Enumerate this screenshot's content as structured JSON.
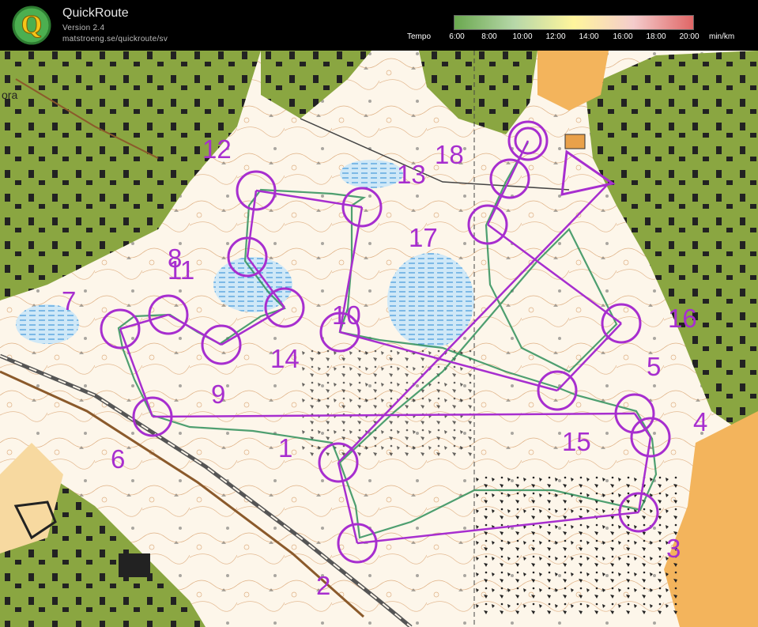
{
  "app": {
    "title": "QuickRoute",
    "version": "Version 2.4",
    "url": "matstroeng.se/quickroute/sv",
    "logo_letter": "Q"
  },
  "tempo_scale": {
    "label": "Tempo",
    "ticks": [
      "6:00",
      "8:00",
      "10:00",
      "12:00",
      "14:00",
      "16:00",
      "18:00",
      "20:00"
    ],
    "unit": "min/km",
    "colors": [
      "#6aa84f",
      "#b6d7a8",
      "#fff59d",
      "#f4cccc",
      "#e06666"
    ]
  },
  "map": {
    "place_label": "ora",
    "colors": {
      "open_land": "#fdf6ea",
      "forest_green": "#8aa641",
      "yellow_field": "#f3b45c",
      "water_blue": "#a8d3ef",
      "contour": "#c9803e",
      "course_purple": "#a72ecf",
      "route_green": "#2f8f5a"
    },
    "control_numbers": [
      "1",
      "2",
      "3",
      "4",
      "5",
      "6",
      "7",
      "8",
      "9",
      "10",
      "11",
      "12",
      "13",
      "14",
      "15",
      "16",
      "17",
      "18"
    ]
  }
}
